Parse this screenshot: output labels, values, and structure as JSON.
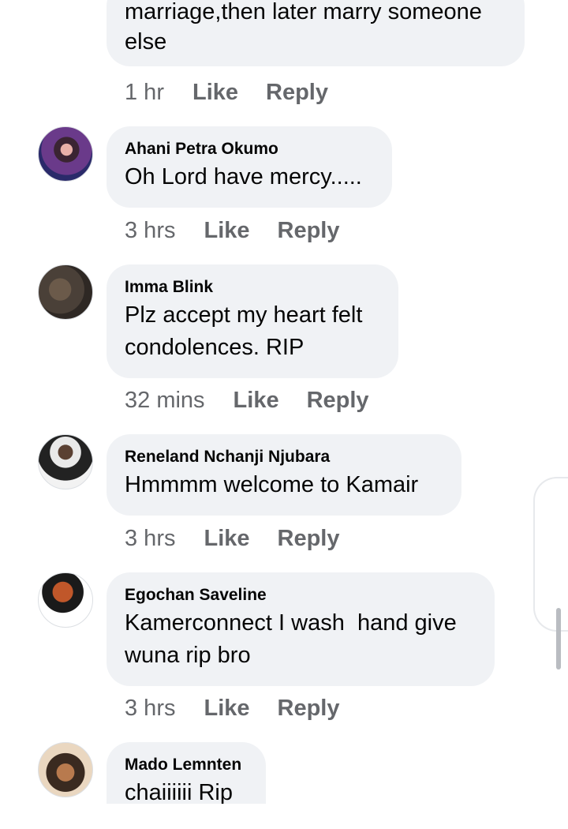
{
  "comments": [
    {
      "author": "",
      "text": "marriage,then later marry someone\nelse",
      "time": "1 hr",
      "like_label": "Like",
      "reply_label": "Reply"
    },
    {
      "author": "Ahani Petra Okumo",
      "text": "Oh Lord have mercy.....",
      "time": "3 hrs",
      "like_label": "Like",
      "reply_label": "Reply"
    },
    {
      "author": "Imma Blink",
      "text": "Plz accept my heart felt\ncondolences. RIP",
      "time": "32 mins",
      "like_label": "Like",
      "reply_label": "Reply"
    },
    {
      "author": "Reneland Nchanji Njubara",
      "text": "Hmmmm welcome to Kamair",
      "time": "3 hrs",
      "like_label": "Like",
      "reply_label": "Reply"
    },
    {
      "author": "Egochan Saveline",
      "text": "Kamerconnect I wash  hand give\nwuna rip bro",
      "time": "3 hrs",
      "like_label": "Like",
      "reply_label": "Reply"
    },
    {
      "author": "Mado Lemnten",
      "text": "chaiiiiii Rip",
      "time": "",
      "like_label": "",
      "reply_label": ""
    }
  ],
  "colors": {
    "bubble": "#f0f2f5",
    "meta_text": "#65676b",
    "body_text": "#050505"
  }
}
